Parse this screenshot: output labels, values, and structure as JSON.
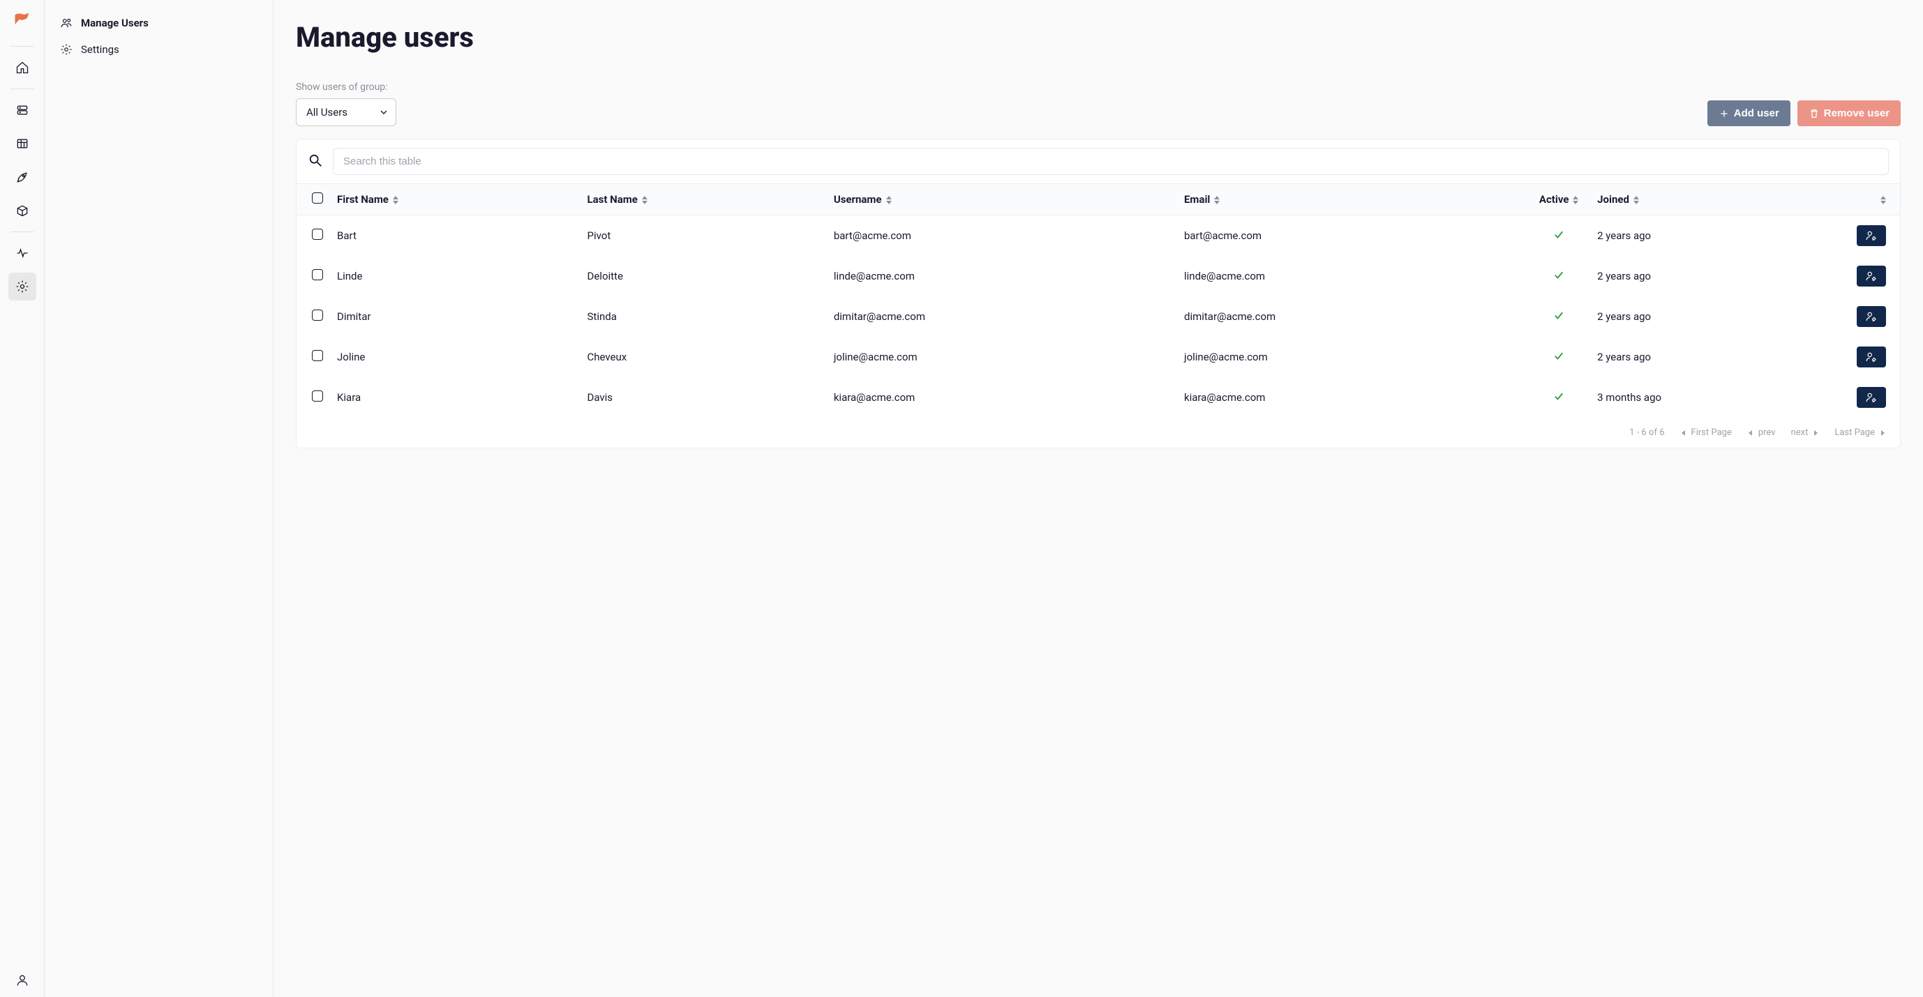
{
  "sidebar": {
    "items": [
      {
        "label": "Manage Users",
        "active": true
      },
      {
        "label": "Settings",
        "active": false
      }
    ]
  },
  "page": {
    "title": "Manage users",
    "filter_label": "Show users of group:",
    "group_select": "All Users"
  },
  "buttons": {
    "add_user": "Add user",
    "remove_user": "Remove user"
  },
  "search": {
    "placeholder": "Search this table"
  },
  "columns": {
    "first_name": "First Name",
    "last_name": "Last Name",
    "username": "Username",
    "email": "Email",
    "active": "Active",
    "joined": "Joined"
  },
  "users": [
    {
      "first": "Bart",
      "last": "Pivot",
      "username": "bart@acme.com",
      "email": "bart@acme.com",
      "active": true,
      "joined": "2 years ago"
    },
    {
      "first": "Linde",
      "last": "Deloitte",
      "username": "linde@acme.com",
      "email": "linde@acme.com",
      "active": true,
      "joined": "2 years ago"
    },
    {
      "first": "Dimitar",
      "last": "Stinda",
      "username": "dimitar@acme.com",
      "email": "dimitar@acme.com",
      "active": true,
      "joined": "2 years ago"
    },
    {
      "first": "Joline",
      "last": "Cheveux",
      "username": "joline@acme.com",
      "email": "joline@acme.com",
      "active": true,
      "joined": "2 years ago"
    },
    {
      "first": "Kiara",
      "last": "Davis",
      "username": "kiara@acme.com",
      "email": "kiara@acme.com",
      "active": true,
      "joined": "3 months ago"
    }
  ],
  "pager": {
    "range": "1 - 6 of 6",
    "first": "First Page",
    "prev": "prev",
    "next": "next",
    "last": "Last Page"
  }
}
